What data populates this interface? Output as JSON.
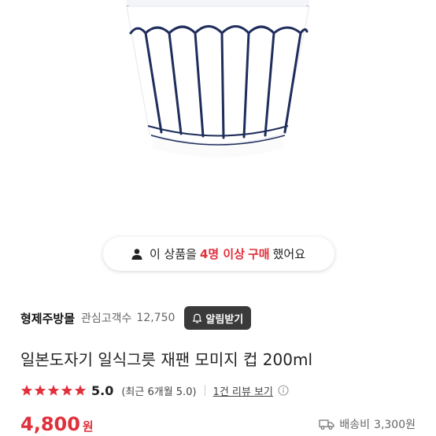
{
  "product_image": {
    "alt": ""
  },
  "banner": {
    "prefix": "이 상품을",
    "count": "4명 이상",
    "action": "구매",
    "suffix": "했어요"
  },
  "seller": {
    "name": "형제주방몰",
    "followers_label": "관심고객수",
    "followers_count": "12,750",
    "alert_label": "알림받기"
  },
  "product": {
    "title": "일본도자기 일식그릇 재팬 모미지 컵 200ml"
  },
  "rating": {
    "stars": 5,
    "value": "5.0",
    "recent": "(최근 6개월 5.0)",
    "review_link": "1건 리뷰 보기"
  },
  "price": {
    "value": "4,800",
    "unit": "원"
  },
  "shipping": {
    "label": "배송비",
    "fee": "3,300원"
  },
  "colors": {
    "accent": "#e0303b",
    "star": "#e0303b",
    "cup_stripe": "#1f2d5c"
  }
}
